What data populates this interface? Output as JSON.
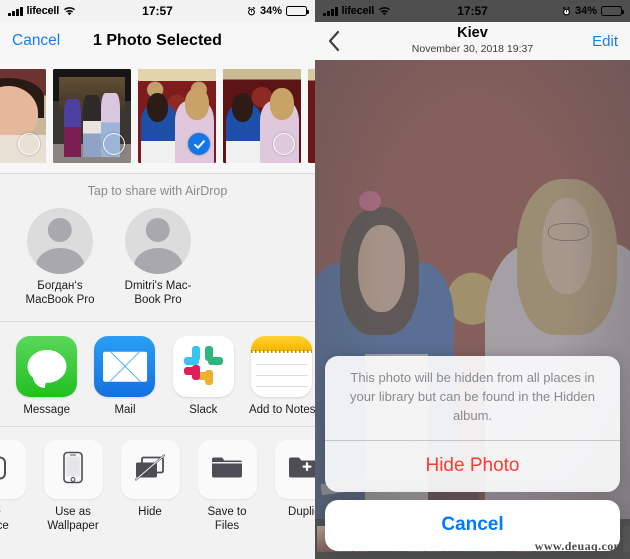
{
  "left_panel": {
    "status_bar": {
      "carrier": "lifecell",
      "time": "17:57",
      "battery_pct": "34%",
      "signal_icon": "signal-bars-icon",
      "wifi_icon": "wifi-icon",
      "alarm_icon": "alarm-clock-icon",
      "battery_icon": "battery-icon"
    },
    "header": {
      "cancel_label": "Cancel",
      "title": "1 Photo Selected"
    },
    "thumbnails": [
      {
        "name": "photo-thumbnail-1",
        "selected": false,
        "partial": true
      },
      {
        "name": "photo-thumbnail-2",
        "selected": false,
        "partial": false
      },
      {
        "name": "photo-thumbnail-3",
        "selected": true,
        "partial": false
      },
      {
        "name": "photo-thumbnail-4",
        "selected": false,
        "partial": false
      },
      {
        "name": "photo-thumbnail-5",
        "selected": false,
        "partial": true
      }
    ],
    "airdrop": {
      "title": "Tap to share with AirDrop",
      "contacts": [
        {
          "label": "Богдан‘s MacBook Pro",
          "avatar_icon": "person-avatar-icon"
        },
        {
          "label": "Dmitri's Mac-Book Pro",
          "avatar_icon": "person-avatar-icon"
        }
      ]
    },
    "apps": [
      {
        "label": "Message",
        "icon": "messages-app-icon"
      },
      {
        "label": "Mail",
        "icon": "mail-app-icon"
      },
      {
        "label": "Slack",
        "icon": "slack-app-icon"
      },
      {
        "label": "Add to Notes",
        "icon": "notes-app-icon"
      }
    ],
    "actions": [
      {
        "label": "te\nFace",
        "icon": "watch-face-icon",
        "partial": true
      },
      {
        "label": "Use as\nWallpaper",
        "icon": "wallpaper-iphone-icon",
        "partial": false
      },
      {
        "label": "Hide",
        "icon": "hide-slash-icon",
        "partial": false
      },
      {
        "label": "Save to Files",
        "icon": "folder-icon",
        "partial": false
      },
      {
        "label": "Duplic",
        "icon": "duplicate-plus-icon",
        "partial": true
      }
    ]
  },
  "right_panel": {
    "status_bar": {
      "carrier": "lifecell",
      "time": "17:57",
      "battery_pct": "34%"
    },
    "header": {
      "back_icon": "back-chevron-icon",
      "title": "Kiev",
      "subtitle": "November 30, 2018  19:37",
      "edit_label": "Edit"
    },
    "photo": {
      "name": "full-photo-two-women-carpet"
    },
    "action_sheet": {
      "message": "This photo will be hidden from all places in your library but can be found in the Hidden album.",
      "hide_label": "Hide Photo",
      "cancel_label": "Cancel",
      "destructive_color": "#ff3b30",
      "accent_color": "#007aff"
    }
  },
  "watermark": "www.deuaq.com"
}
